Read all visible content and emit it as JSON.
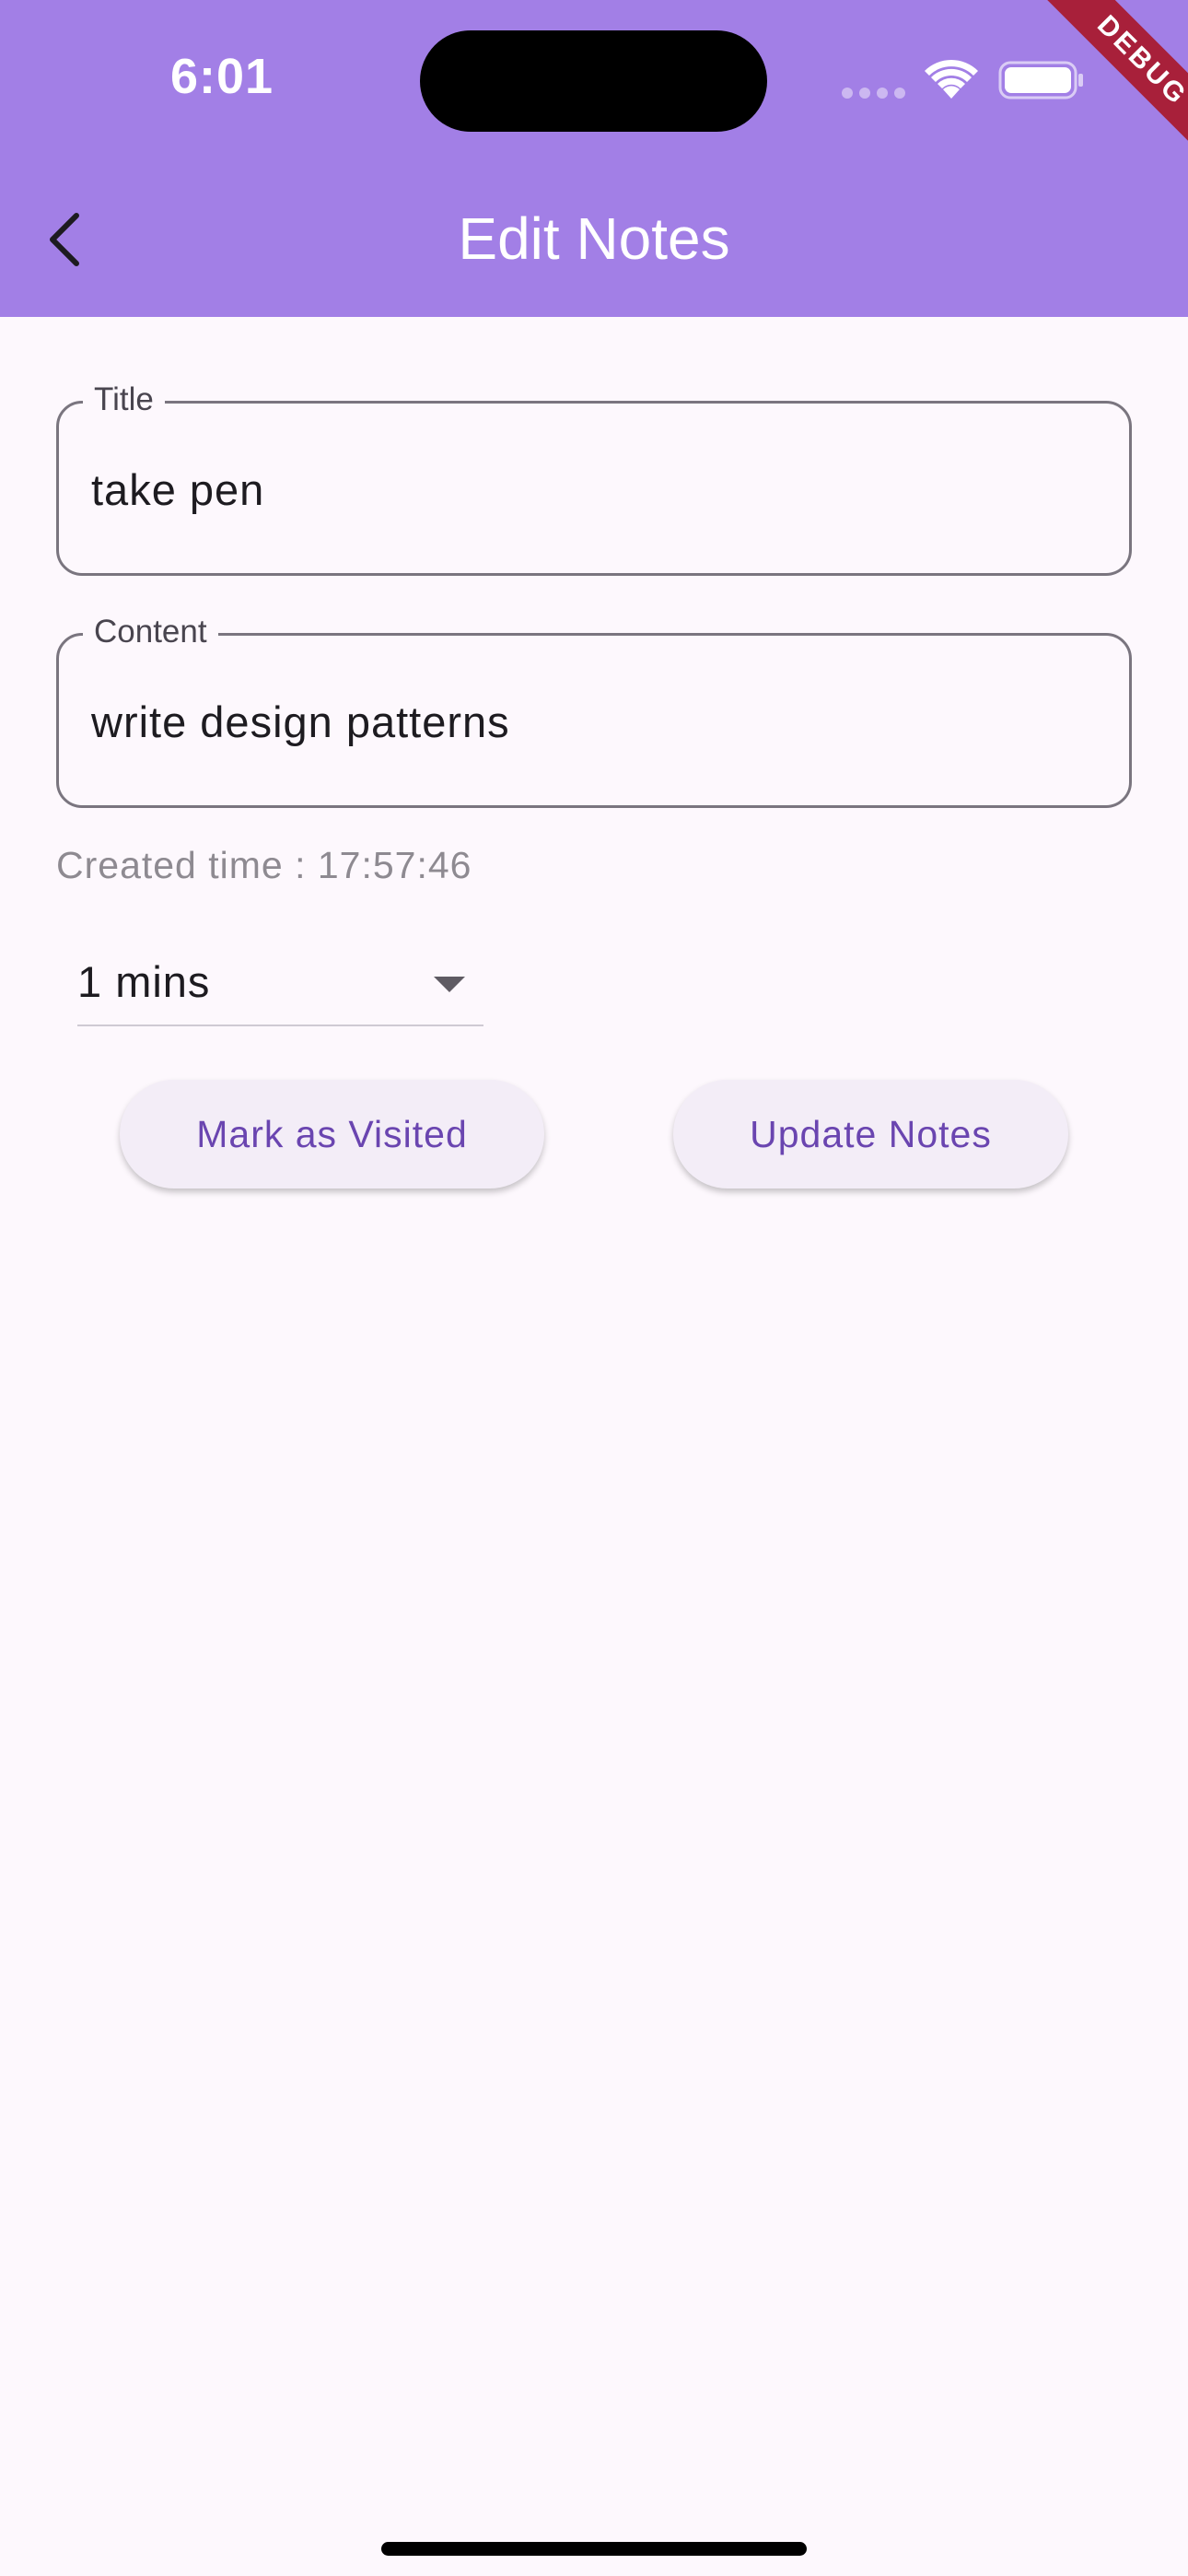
{
  "status_bar": {
    "time": "6:01",
    "debug_label": "DEBUG"
  },
  "header": {
    "title": "Edit Notes",
    "back_icon": "chevron-left-icon"
  },
  "form": {
    "title_field": {
      "label": "Title",
      "value": "take pen"
    },
    "content_field": {
      "label": "Content",
      "value": "write design patterns"
    },
    "created_time": "Created time : 17:57:46",
    "reminder_dropdown": {
      "selected": "1 mins"
    }
  },
  "actions": {
    "mark_visited_label": "Mark as Visited",
    "update_label": "Update Notes"
  },
  "colors": {
    "appbar": "#a27fe6",
    "background": "#fdf8fd",
    "button_text": "#6a45b0",
    "debug_ribbon": "#a8203a"
  }
}
